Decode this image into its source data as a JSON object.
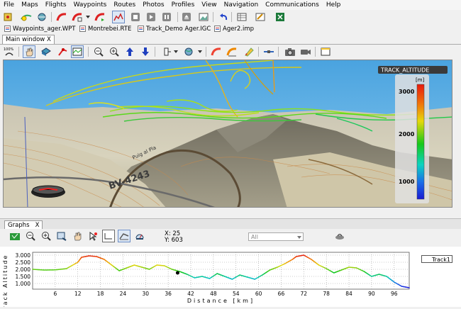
{
  "menu": [
    "File",
    "Maps",
    "Flights",
    "Waypoints",
    "Routes",
    "Photos",
    "Profiles",
    "View",
    "Navigation",
    "Communications",
    "Help"
  ],
  "file_tabs": [
    "Waypoints_ager.WPT",
    "Montrebei.RTE",
    "Track_Demo Ager.IGC",
    "Ager2.imp"
  ],
  "main_tab_label": "Main window",
  "map": {
    "compass_label": "100%",
    "road_label": "BV-4243",
    "place_label": "Puig al Pla",
    "legend_title": "TRACK_ALTITUDE",
    "legend_unit": "[m]",
    "legend_ticks": [
      "3000",
      "2000",
      "1000"
    ]
  },
  "graphs_tab_label": "Graphs",
  "graphs_tab_close": "X",
  "main_tab_close": "X",
  "coords": {
    "x_label": "X: 25",
    "y_label": "Y: 603"
  },
  "dropdown_value": "All",
  "track_button": "Track1",
  "chart_data": {
    "type": "line",
    "title": "",
    "xlabel": "Distance [km]",
    "ylabel": "Track Altitude",
    "x_ticks": [
      6,
      12,
      18,
      24,
      30,
      36,
      42,
      48,
      54,
      60,
      66,
      72,
      78,
      84,
      90,
      96
    ],
    "y_ticks": [
      "3.000",
      "2.500",
      "2.000",
      "1.500",
      "1.000"
    ],
    "xlim": [
      0,
      100
    ],
    "ylim": [
      600,
      3200
    ],
    "series": [
      {
        "x": [
          0,
          3,
          6,
          9,
          12,
          13,
          15,
          17,
          19,
          21,
          23,
          25,
          27,
          29,
          31,
          33,
          35,
          37,
          39,
          41,
          43,
          45,
          47,
          49,
          51,
          53,
          55,
          57,
          59,
          61,
          63,
          65,
          67,
          69,
          70,
          72,
          74,
          76,
          78,
          80,
          82,
          84,
          86,
          88,
          90,
          92,
          94,
          96,
          98,
          100
        ],
        "y": [
          2000,
          1950,
          1960,
          2050,
          2500,
          2850,
          2950,
          2900,
          2700,
          2300,
          1900,
          2100,
          2300,
          2150,
          2000,
          2300,
          2250,
          2000,
          1850,
          1650,
          1400,
          1500,
          1350,
          1700,
          1500,
          1300,
          1600,
          1450,
          1300,
          1600,
          1950,
          2150,
          2400,
          2700,
          2900,
          3000,
          2700,
          2300,
          2050,
          1750,
          1950,
          2150,
          2100,
          1850,
          1500,
          1650,
          1500,
          1100,
          800,
          700
        ]
      }
    ],
    "marker": {
      "x": 38.5,
      "y": 1750
    }
  }
}
